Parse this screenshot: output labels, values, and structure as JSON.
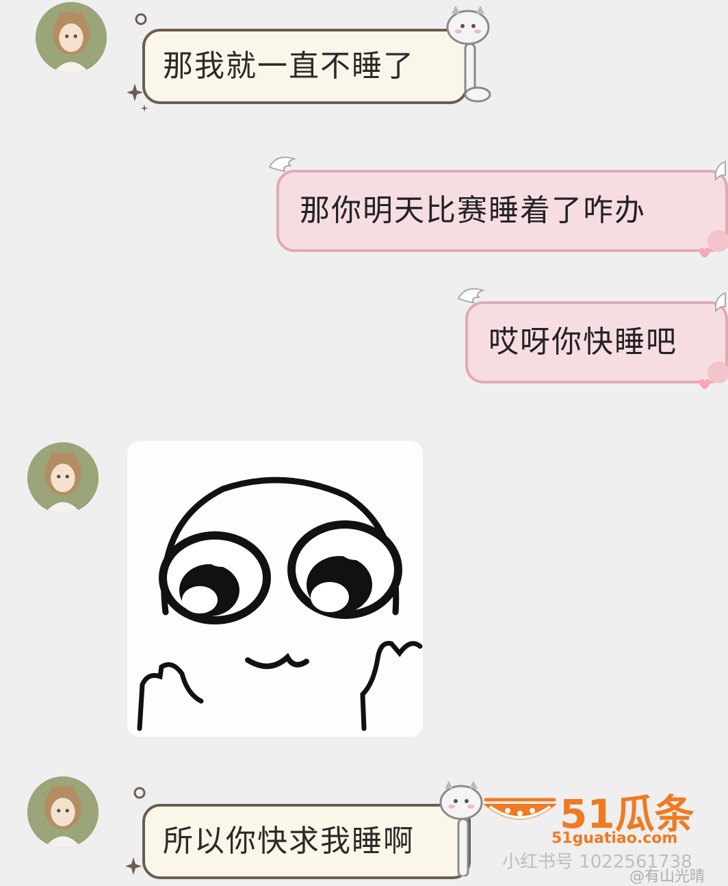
{
  "messages": [
    {
      "side": "left",
      "text": "那我就一直不睡了"
    },
    {
      "side": "right",
      "text": "那你明天比赛睡着了咋办"
    },
    {
      "side": "right",
      "text": "哎呀你快睡吧"
    },
    {
      "side": "left",
      "type": "sticker"
    },
    {
      "side": "left",
      "text": "所以你快求我睡啊"
    }
  ],
  "watermark": {
    "brand": "51瓜条",
    "site": "51guatiao.com",
    "xhs": "小红书号 1022561738",
    "weibo": "@有山光晴"
  },
  "colors": {
    "background": "#efefef",
    "left_bubble_bg": "#fbf6ea",
    "left_bubble_border": "#6b5d52",
    "right_bubble_bg": "#f6dde2",
    "right_bubble_border": "#e2a9b3",
    "brand_orange": "#f07a22"
  }
}
